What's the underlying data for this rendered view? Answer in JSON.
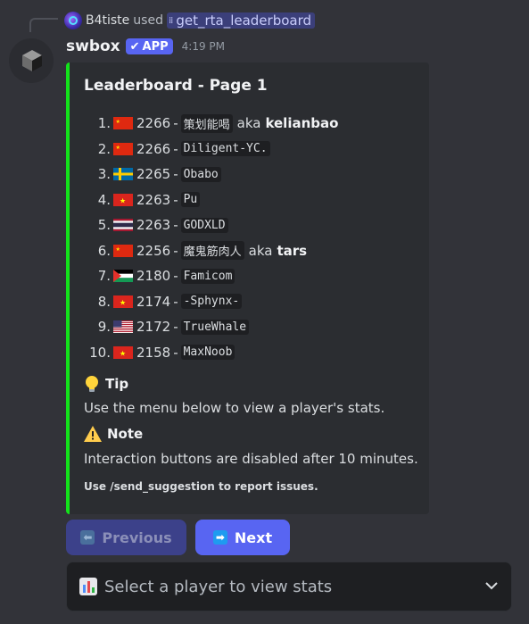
{
  "reply": {
    "user": "B4tiste",
    "used_text": "used",
    "command": "get_rta_leaderboard",
    "command_icon": "slash-command-icon"
  },
  "message": {
    "username": "swbox",
    "badge": "APP",
    "timestamp": "4:19 PM"
  },
  "embed": {
    "accent_color": "#13e21b",
    "title": "Leaderboard - Page 1",
    "rows": [
      {
        "rank": "1.",
        "flag": "CN",
        "score": "2266",
        "name": "策划能喝",
        "aka": "aka",
        "alias": "kelianbao"
      },
      {
        "rank": "2.",
        "flag": "CN",
        "score": "2266",
        "name": "Diligent-YC.",
        "aka": "",
        "alias": ""
      },
      {
        "rank": "3.",
        "flag": "SE",
        "score": "2265",
        "name": "Obabo",
        "aka": "",
        "alias": ""
      },
      {
        "rank": "4.",
        "flag": "VN",
        "score": "2263",
        "name": "Pu ",
        "aka": "",
        "alias": ""
      },
      {
        "rank": "5.",
        "flag": "TH",
        "score": "2263",
        "name": "GODXLD",
        "aka": "",
        "alias": ""
      },
      {
        "rank": "6.",
        "flag": "CN",
        "score": "2256",
        "name": "魔鬼筋肉人",
        "aka": "aka",
        "alias": "tars"
      },
      {
        "rank": "7.",
        "flag": "PS",
        "score": "2180",
        "name": "Famicom",
        "aka": "",
        "alias": ""
      },
      {
        "rank": "8.",
        "flag": "VN",
        "score": "2174",
        "name": "-Sphynx-",
        "aka": "",
        "alias": ""
      },
      {
        "rank": "9.",
        "flag": "US",
        "score": "2172",
        "name": "TrueWhale",
        "aka": "",
        "alias": ""
      },
      {
        "rank": "10.",
        "flag": "VN",
        "score": "2158",
        "name": "MaxNoob",
        "aka": "",
        "alias": ""
      }
    ],
    "separator": "-",
    "tip_icon": "lightbulb-icon",
    "tip_title": "Tip",
    "tip_text": "Use the menu below to view a player's stats.",
    "note_icon": "warning-icon",
    "note_title": "Note",
    "note_text": "Interaction buttons are disabled after 10 minutes.",
    "footer": "Use /send_suggestion to report issues."
  },
  "buttons": {
    "previous_label": "Previous",
    "previous_disabled": true,
    "next_label": "Next"
  },
  "select": {
    "placeholder": "Select a player to view stats",
    "icon": "bar-chart-icon"
  },
  "colors": {
    "background": "#323339",
    "embed_bg": "#2b2d31",
    "blurple": "#5865f2"
  }
}
